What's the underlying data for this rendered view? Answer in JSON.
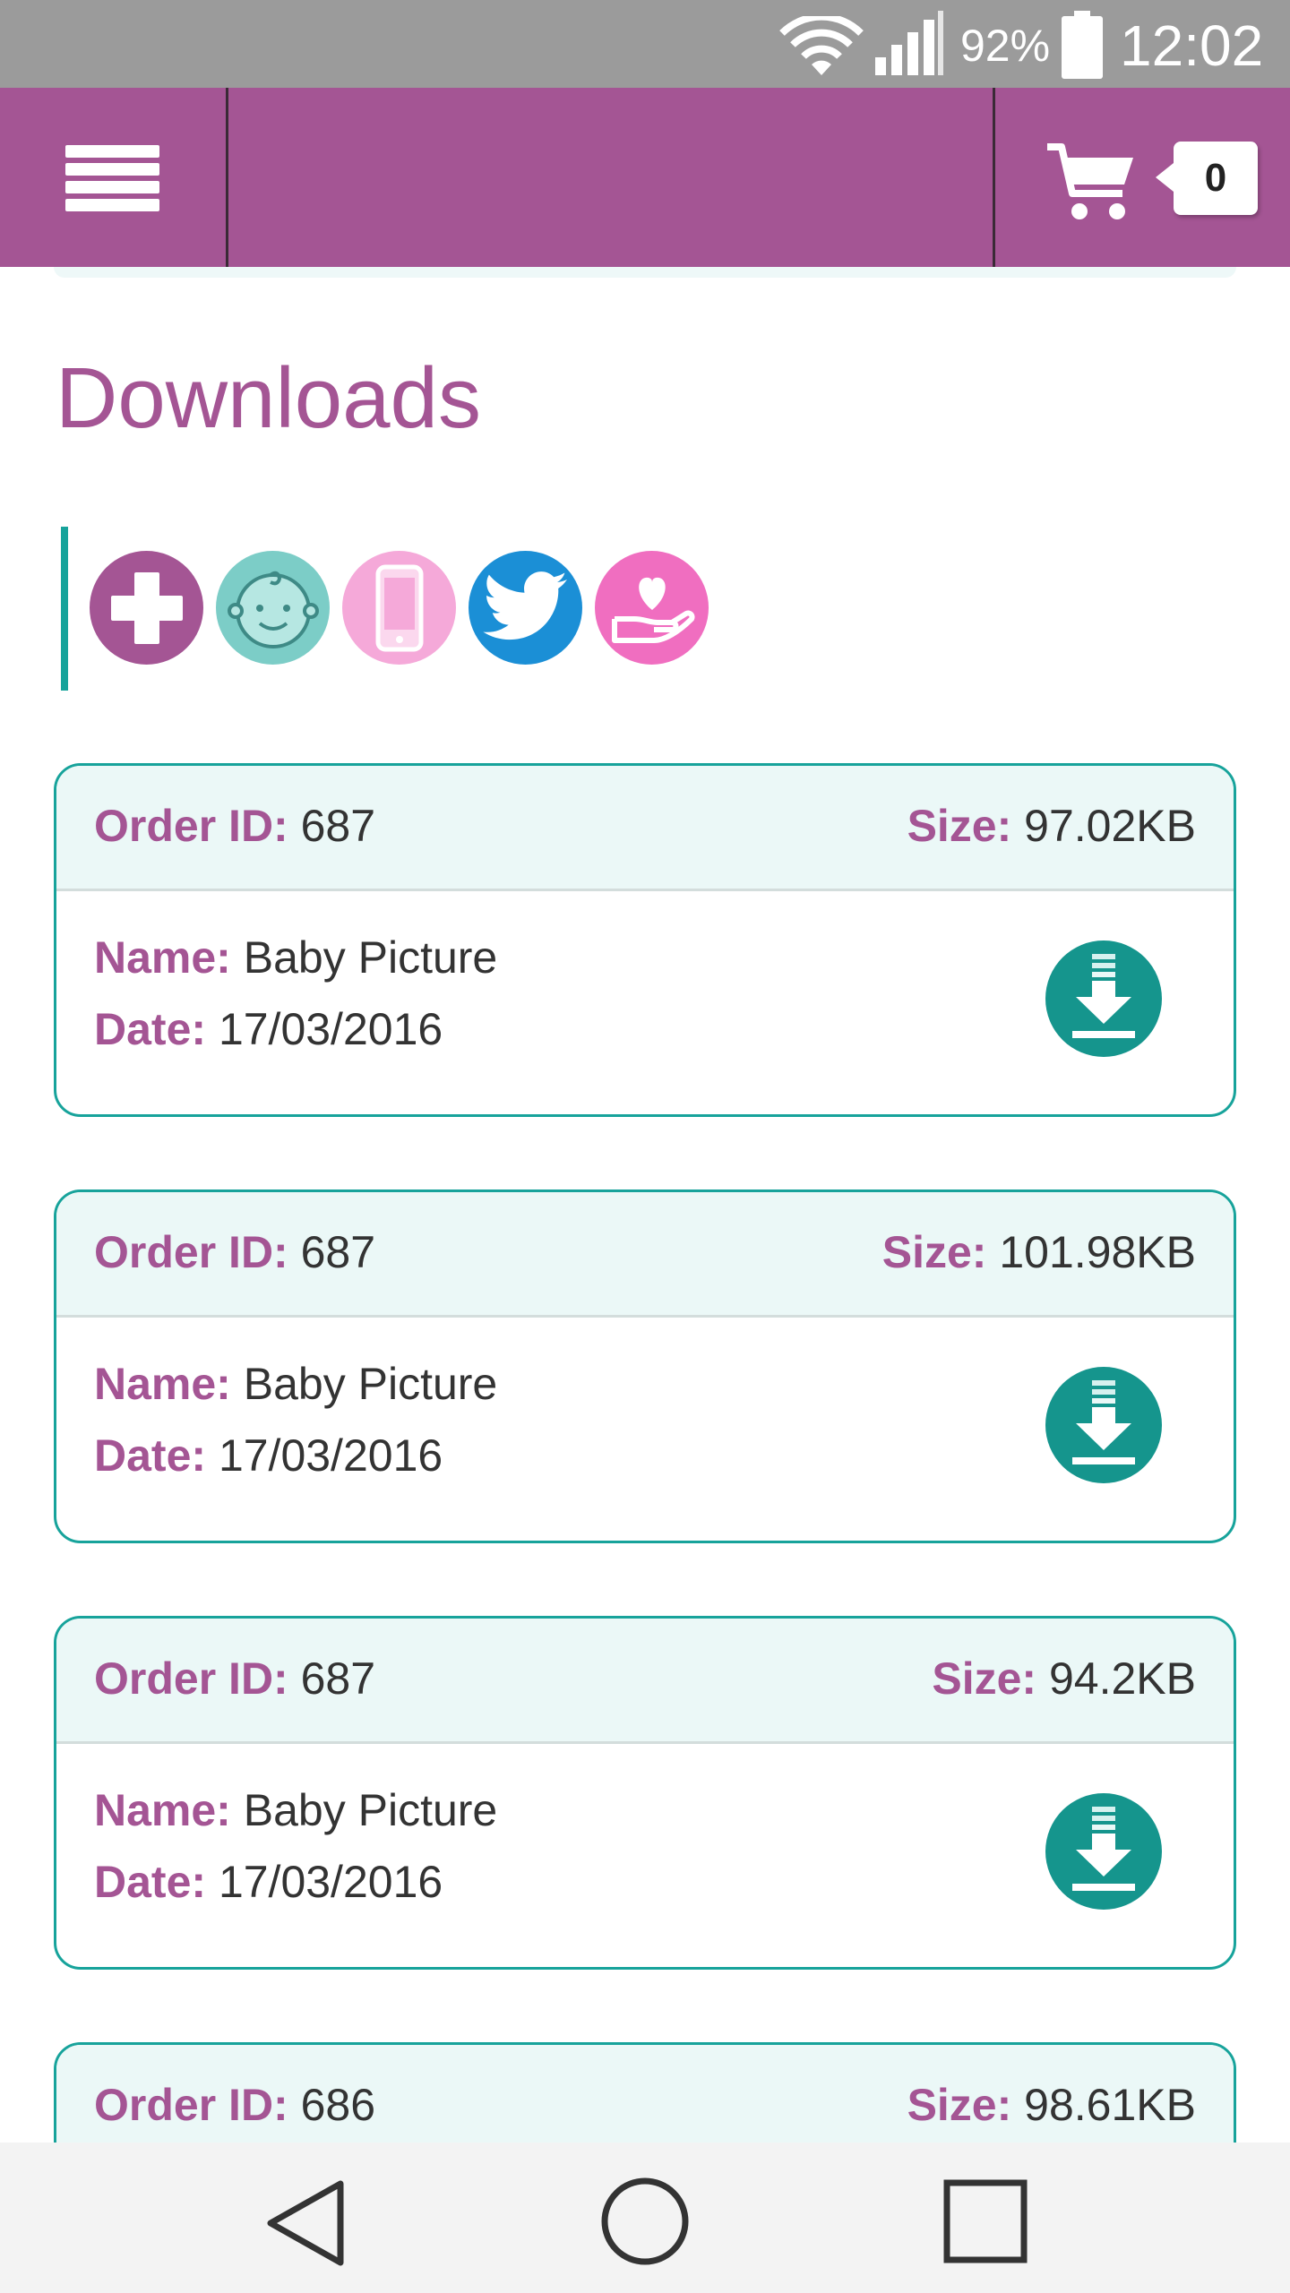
{
  "status_bar": {
    "battery_percent": "92%",
    "time": "12:02",
    "icons": [
      "wifi-icon",
      "signal-icon",
      "battery-icon"
    ]
  },
  "header": {
    "menu_icon": "hamburger-menu-icon",
    "cart_icon": "shopping-cart-icon",
    "cart_count": "0",
    "brand_color": "#a45594"
  },
  "page": {
    "title": "Downloads"
  },
  "icon_row": [
    {
      "name": "medical-cross-icon",
      "color": "#a45594"
    },
    {
      "name": "baby-face-icon",
      "color": "#7ccdc7"
    },
    {
      "name": "mobile-phone-icon",
      "color": "#f5a9d9"
    },
    {
      "name": "twitter-bird-icon",
      "color": "#1b8fd6"
    },
    {
      "name": "heart-hand-icon",
      "color": "#f06ec0"
    }
  ],
  "labels": {
    "order_id": "Order ID:",
    "size": "Size:",
    "name": "Name:",
    "date": "Date:"
  },
  "orders": [
    {
      "order_id": "687",
      "size": "97.02KB",
      "name": "Baby Picture",
      "date": "17/03/2016"
    },
    {
      "order_id": "687",
      "size": "101.98KB",
      "name": "Baby Picture",
      "date": "17/03/2016"
    },
    {
      "order_id": "687",
      "size": "94.2KB",
      "name": "Baby Picture",
      "date": "17/03/2016"
    },
    {
      "order_id": "686",
      "size": "98.61KB"
    }
  ],
  "accent_color": "#17a39b",
  "nav_bar": {
    "icons": [
      "back-icon",
      "home-icon",
      "recent-apps-icon"
    ]
  }
}
